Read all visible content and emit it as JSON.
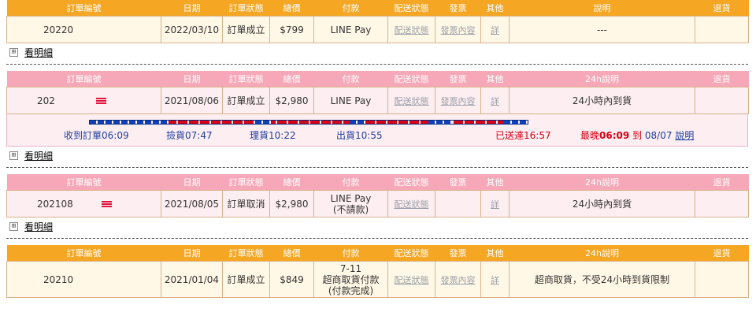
{
  "headers": {
    "order_no": "訂單編號",
    "date": "日期",
    "status": "訂單狀態",
    "total": "總價",
    "payment": "付款",
    "shipping": "配送狀態",
    "invoice": "發票",
    "other": "其他",
    "note": "說明",
    "note24": "24h說明",
    "return": "退貨"
  },
  "detail_label": "看明細",
  "expand_icon": "⊞",
  "orders": [
    {
      "order_no": "20220",
      "date": "2022/03/10",
      "status": "訂單成立",
      "total": "$799",
      "payment": "LINE Pay",
      "shipping": "配送狀態",
      "invoice": "發票內容",
      "other": "詳",
      "note": "---"
    },
    {
      "order_no": "202",
      "date": "2021/08/06",
      "status": "訂單成立",
      "total": "$2,980",
      "payment": "LINE Pay",
      "shipping": "配送狀態",
      "invoice": "發票內容",
      "other": "詳",
      "note": "24小時內到貨",
      "progress": {
        "received": "收到訂單06:09",
        "picked": "撿貨07:47",
        "packed": "理貨10:22",
        "shipped": "出貨10:55",
        "delivered": "已送達16:57",
        "latest_prefix": "最晚",
        "latest_time": "06:09",
        "latest_mid": "到",
        "latest_date": "08/07",
        "explain": "說明"
      }
    },
    {
      "order_no": "202108",
      "date": "2021/08/05",
      "status": "訂單取消",
      "total": "$2,980",
      "payment_line1": "LINE Pay",
      "payment_line2": "(不請款)",
      "shipping": "配送狀態",
      "other": "詳",
      "note": "24小時內到貨"
    },
    {
      "order_no": "20210",
      "date": "2021/01/04",
      "status": "訂單成立",
      "total": "$849",
      "payment_line1": "7-11",
      "payment_line2": "超商取貨付款",
      "payment_line3": "(付款完成)",
      "shipping": "配送狀態",
      "invoice": "發票內容",
      "other": "詳",
      "note": "超商取貨，不受24小時到貨限制"
    }
  ],
  "colors": {
    "orange_header": "#f5a623",
    "pink_header": "#f7a8b8",
    "accent_red": "#d90015",
    "link_blue": "#1e3fa0"
  }
}
